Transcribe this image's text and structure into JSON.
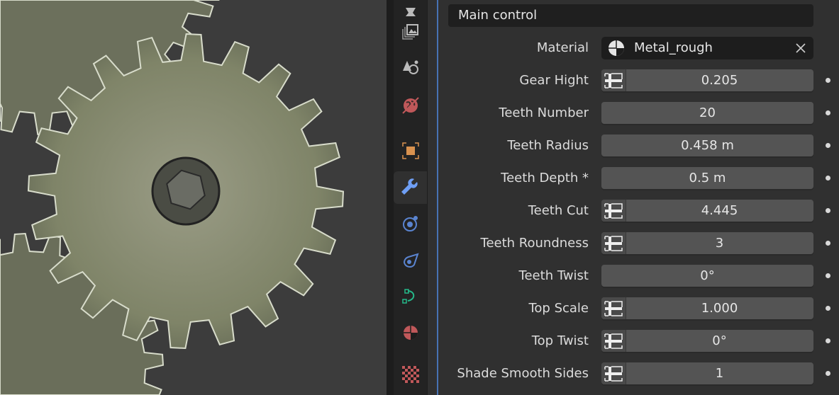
{
  "panel": {
    "title": "Main control"
  },
  "tabs": [
    {
      "name": "render-icon"
    },
    {
      "name": "output-icon"
    },
    {
      "name": "view-layer-icon"
    },
    {
      "name": "scene-icon"
    },
    {
      "name": "world-icon"
    },
    {
      "name": "object-icon"
    },
    {
      "name": "modifier-icon",
      "active": true
    },
    {
      "name": "particles-icon"
    },
    {
      "name": "physics-icon"
    },
    {
      "name": "constraints-icon"
    },
    {
      "name": "material-icon"
    },
    {
      "name": "texture-icon"
    }
  ],
  "material": {
    "label": "Material",
    "value": "Metal_rough"
  },
  "properties": [
    {
      "label": "Gear Hight",
      "value": "0.205",
      "toggle": true
    },
    {
      "label": "Teeth Number",
      "value": "20",
      "toggle": false
    },
    {
      "label": "Teeth Radius",
      "value": "0.458 m",
      "toggle": false
    },
    {
      "label": "Teeth Depth *",
      "value": "0.5 m",
      "toggle": false
    },
    {
      "label": "Teeth Cut",
      "value": "4.445",
      "toggle": true
    },
    {
      "label": "Teeth Roundness",
      "value": "3",
      "toggle": true
    },
    {
      "label": "Teeth Twist",
      "value": "0°",
      "toggle": false
    },
    {
      "label": "Top Scale",
      "value": "1.000",
      "toggle": true
    },
    {
      "label": "Top Twist",
      "value": "0°",
      "toggle": true
    },
    {
      "label": "Shade Smooth Sides",
      "value": "1",
      "toggle": true
    }
  ],
  "colors": {
    "accent": "#4772b3",
    "gear": "#8e9178",
    "field": "#545454"
  }
}
